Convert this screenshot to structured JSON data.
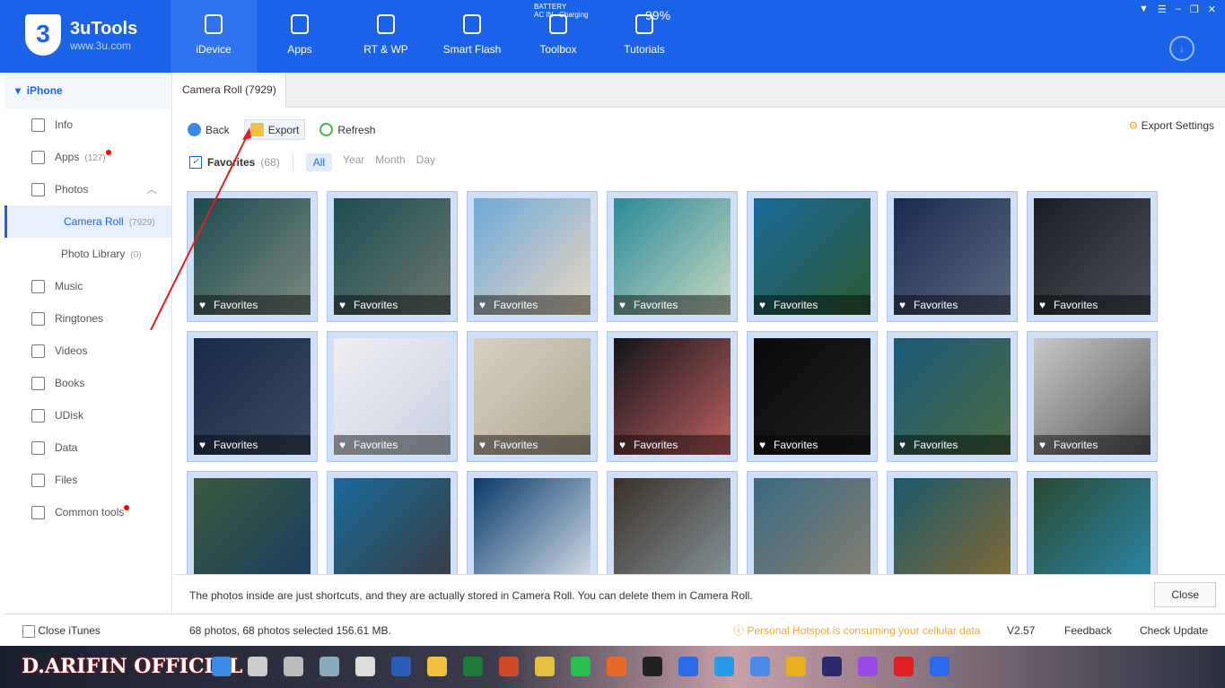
{
  "app": {
    "name": "3uTools",
    "url": "www.3u.com",
    "logo_char": "3"
  },
  "nav": [
    {
      "label": "iDevice",
      "active": true
    },
    {
      "label": "Apps"
    },
    {
      "label": "RT & WP"
    },
    {
      "label": "Smart Flash"
    },
    {
      "label": "Toolbox"
    },
    {
      "label": "Tutorials"
    }
  ],
  "battery": {
    "label": "BATTERY",
    "source": "AC IN",
    "state": "Charging",
    "percent": "99%"
  },
  "sidebar": {
    "device": "iPhone",
    "items": [
      {
        "label": "Info"
      },
      {
        "label": "Apps",
        "count": "(127)",
        "dot": true
      },
      {
        "label": "Photos",
        "expanded": true
      },
      {
        "label": "Camera Roll",
        "count": "(7929)",
        "sub": true,
        "active": true
      },
      {
        "label": "Photo Library",
        "count": "(0)",
        "sub": true
      },
      {
        "label": "Music"
      },
      {
        "label": "Ringtones"
      },
      {
        "label": "Videos"
      },
      {
        "label": "Books"
      },
      {
        "label": "UDisk"
      },
      {
        "label": "Data"
      },
      {
        "label": "Files"
      },
      {
        "label": "Common tools",
        "dot": true
      }
    ]
  },
  "tab": "Camera Roll (7929)",
  "toolbar": {
    "back": "Back",
    "export": "Export",
    "refresh": "Refresh",
    "export_settings": "Export Settings"
  },
  "filter": {
    "favorites": "Favorites",
    "count": "(68)",
    "periods": [
      "All",
      "Year",
      "Month",
      "Day"
    ],
    "active": "All"
  },
  "photos": {
    "badge": "Favorites",
    "tiles": [
      [
        "#1e4a50",
        "#7a8a80"
      ],
      [
        "#1d4d52",
        "#6b7770"
      ],
      [
        "#6fa8d8",
        "#e8d8c0"
      ],
      [
        "#2a8a98",
        "#c8d8c0"
      ],
      [
        "#1a6a9a",
        "#2a5a30"
      ],
      [
        "#1a2a50",
        "#5a6a80"
      ],
      [
        "#1a1e24",
        "#4a5058"
      ],
      [
        "#1a2a48",
        "#3a4a60"
      ],
      [
        "#f0f0f4",
        "#c8d0e0"
      ],
      [
        "#d8d0c0",
        "#b0a890"
      ],
      [
        "#101418",
        "#c06060"
      ],
      [
        "#0a0a0a",
        "#202020"
      ],
      [
        "#1a5a7a",
        "#4a6a40"
      ],
      [
        "#c8c8c8",
        "#5a5a5a"
      ],
      [
        "#3a5a40",
        "#1a3a60"
      ],
      [
        "#1a6a9a",
        "#3a3a3a"
      ],
      [
        "#0a3a6a",
        "#e0e8f0"
      ],
      [
        "#3a3028",
        "#8a9aa0"
      ],
      [
        "#3a6a80",
        "#8a8070"
      ],
      [
        "#1a5a6a",
        "#8a6a30"
      ],
      [
        "#2a4a30",
        "#2a8ab0"
      ]
    ]
  },
  "notice": "The photos inside are just shortcuts, and they are actually stored in Camera Roll. You can delete them in Camera Roll.",
  "close_label": "Close",
  "status": {
    "close_itunes": "Close iTunes",
    "summary": "68 photos, 68 photos selected 156.61 MB.",
    "warning": "Personal Hotspot is consuming your cellular data",
    "version": "V2.57",
    "feedback": "Feedback",
    "check_update": "Check Update"
  },
  "taskbar": {
    "channel": "D.ARIFIN OFFICIAL"
  },
  "colors": {
    "brand": "#1a63e8",
    "warning": "#e8a93a"
  }
}
